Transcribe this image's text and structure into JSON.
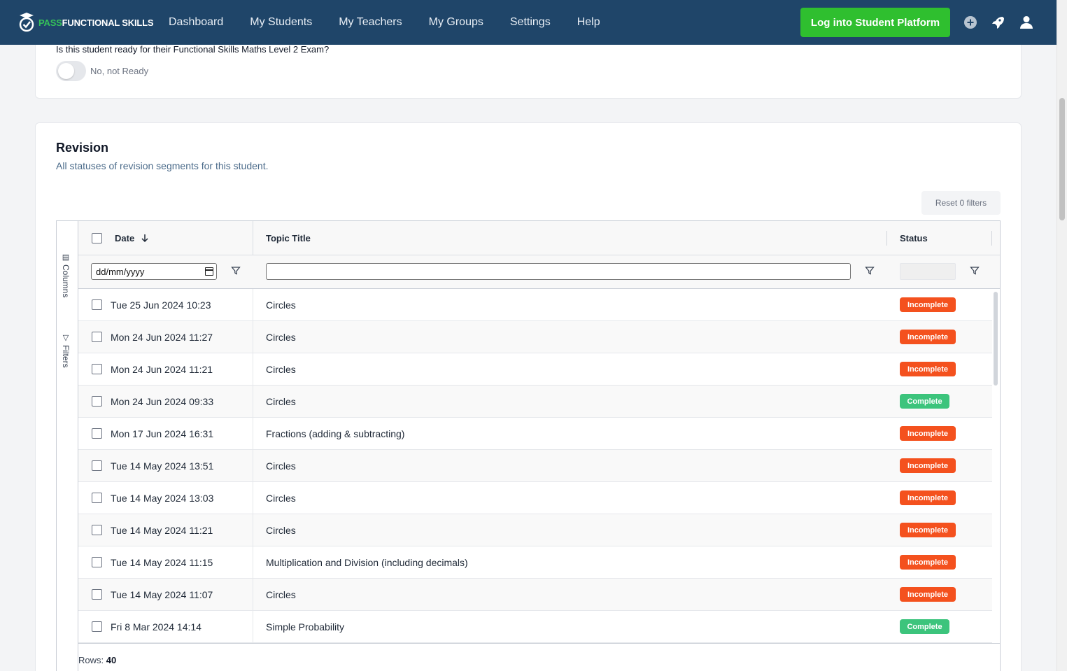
{
  "nav": {
    "logo_pass": "PASS",
    "logo_rest": "FUNCTIONAL SKILLS",
    "links": [
      "Dashboard",
      "My Students",
      "My Teachers",
      "My Groups",
      "Settings",
      "Help"
    ],
    "login_button": "Log into Student Platform"
  },
  "ready": {
    "question": "Is this student ready for their Functional Skills Maths Level 2 Exam?",
    "toggle_label": "No, not Ready"
  },
  "revision": {
    "title": "Revision",
    "subtitle": "All statuses of revision segments for this student.",
    "reset_button": "Reset 0 filters",
    "columns_tab": "Columns",
    "filters_tab": "Filters",
    "headers": {
      "date": "Date",
      "topic": "Topic Title",
      "status": "Status"
    },
    "date_placeholder": "dd/mm/yyyy",
    "rows": [
      {
        "date": "Tue 25 Jun 2024 10:23",
        "topic": "Circles",
        "status": "Incomplete"
      },
      {
        "date": "Mon 24 Jun 2024 11:27",
        "topic": "Circles",
        "status": "Incomplete"
      },
      {
        "date": "Mon 24 Jun 2024 11:21",
        "topic": "Circles",
        "status": "Incomplete"
      },
      {
        "date": "Mon 24 Jun 2024 09:33",
        "topic": "Circles",
        "status": "Complete"
      },
      {
        "date": "Mon 17 Jun 2024 16:31",
        "topic": "Fractions (adding & subtracting)",
        "status": "Incomplete"
      },
      {
        "date": "Tue 14 May 2024 13:51",
        "topic": "Circles",
        "status": "Incomplete"
      },
      {
        "date": "Tue 14 May 2024 13:03",
        "topic": "Circles",
        "status": "Incomplete"
      },
      {
        "date": "Tue 14 May 2024 11:21",
        "topic": "Circles",
        "status": "Incomplete"
      },
      {
        "date": "Tue 14 May 2024 11:15",
        "topic": "Multiplication and Division (including decimals)",
        "status": "Incomplete"
      },
      {
        "date": "Tue 14 May 2024 11:07",
        "topic": "Circles",
        "status": "Incomplete"
      },
      {
        "date": "Fri 8 Mar 2024 14:14",
        "topic": "Simple Probability",
        "status": "Complete"
      }
    ],
    "rows_label": "Rows:",
    "rows_count": "40"
  },
  "colors": {
    "nav_bg": "#1f4569",
    "login_green": "#2fbf2f",
    "incomplete": "#f4511e",
    "complete": "#3cc47c"
  }
}
